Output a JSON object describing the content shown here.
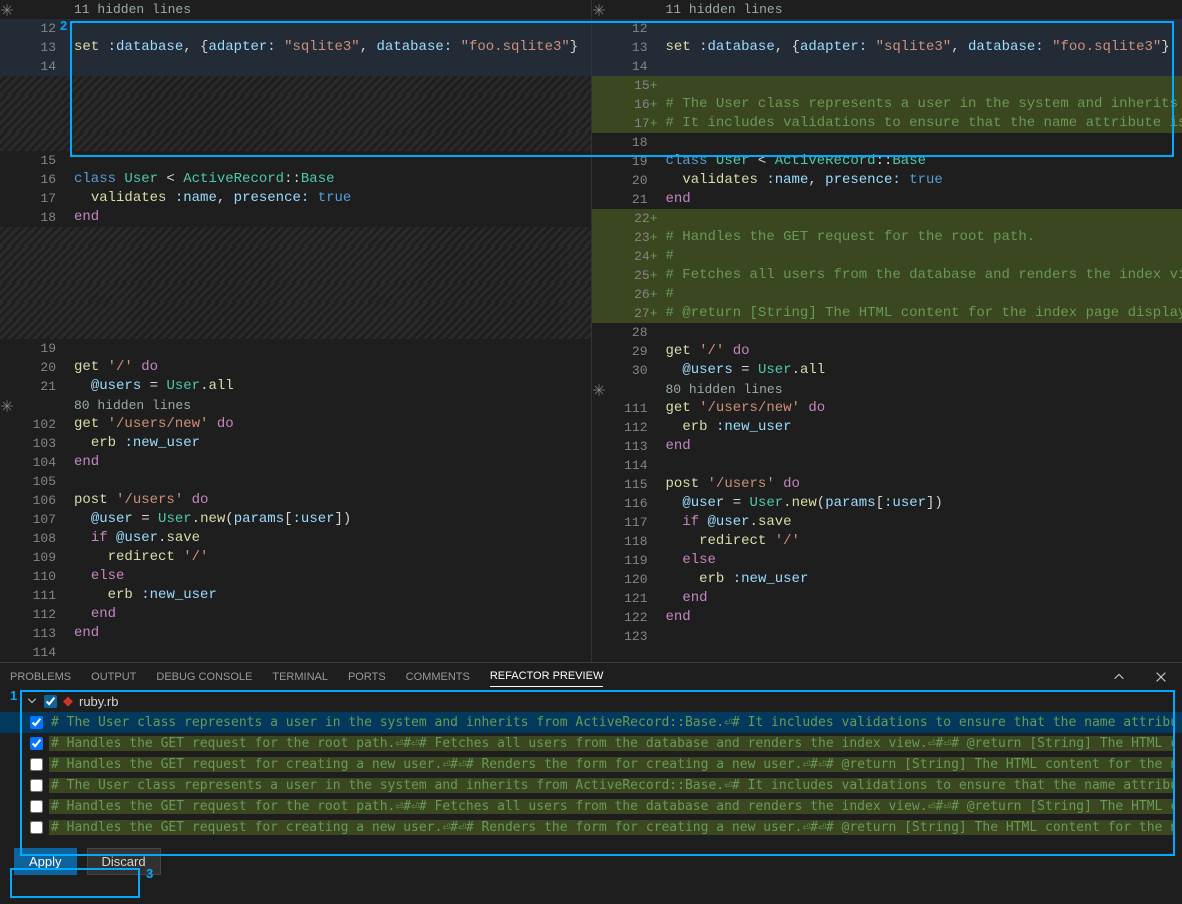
{
  "hidden_top_label": "11 hidden lines",
  "hidden_mid_label": "80 hidden lines",
  "left": {
    "lines": [
      {
        "n": "12",
        "type": "chg",
        "code": ""
      },
      {
        "n": "13",
        "type": "chg",
        "code": "<span class='tok-fn'>set</span> <span class='tok-sym'>:database</span>, {<span class='tok-sym'>adapter:</span> <span class='tok-str'>\"sqlite3\"</span>, <span class='tok-sym'>database:</span> <span class='tok-str'>\"foo.sqlite3\"</span>}"
      },
      {
        "n": "14",
        "type": "chg",
        "code": ""
      },
      {
        "n": "",
        "type": "del",
        "code": ""
      },
      {
        "n": "",
        "type": "del",
        "code": ""
      },
      {
        "n": "",
        "type": "del",
        "code": ""
      },
      {
        "n": "",
        "type": "del",
        "code": ""
      },
      {
        "n": "15",
        "type": "",
        "code": ""
      },
      {
        "n": "16",
        "type": "",
        "code": "<span class='tok-kw'>class</span> <span class='tok-cls'>User</span> &lt; <span class='tok-cls'>ActiveRecord</span>::<span class='tok-cls'>Base</span>"
      },
      {
        "n": "17",
        "type": "",
        "code": "  <span class='tok-fn'>validates</span> <span class='tok-sym'>:name</span>, <span class='tok-sym'>presence:</span> <span class='tok-bool'>true</span>"
      },
      {
        "n": "18",
        "type": "",
        "code": "<span class='tok-mod'>end</span>"
      },
      {
        "n": "",
        "type": "del",
        "code": ""
      },
      {
        "n": "",
        "type": "del",
        "code": ""
      },
      {
        "n": "",
        "type": "del",
        "code": ""
      },
      {
        "n": "",
        "type": "del",
        "code": ""
      },
      {
        "n": "",
        "type": "del",
        "code": ""
      },
      {
        "n": "",
        "type": "del",
        "code": ""
      },
      {
        "n": "19",
        "type": "",
        "code": ""
      },
      {
        "n": "20",
        "type": "",
        "code": "<span class='tok-fn'>get</span> <span class='tok-str'>'/'</span> <span class='tok-mod'>do</span>"
      },
      {
        "n": "21",
        "type": "",
        "code": "  <span class='tok-var'>@users</span> = <span class='tok-cls'>User</span>.<span class='tok-fn'>all</span>"
      }
    ],
    "lines2": [
      {
        "n": "102",
        "type": "",
        "code": "<span class='tok-fn'>get</span> <span class='tok-str'>'/users/new'</span> <span class='tok-mod'>do</span>"
      },
      {
        "n": "103",
        "type": "",
        "code": "  <span class='tok-fn'>erb</span> <span class='tok-sym'>:new_user</span>"
      },
      {
        "n": "104",
        "type": "",
        "code": "<span class='tok-mod'>end</span>"
      },
      {
        "n": "105",
        "type": "",
        "code": ""
      },
      {
        "n": "106",
        "type": "",
        "code": "<span class='tok-fn'>post</span> <span class='tok-str'>'/users'</span> <span class='tok-mod'>do</span>"
      },
      {
        "n": "107",
        "type": "",
        "code": "  <span class='tok-var'>@user</span> = <span class='tok-cls'>User</span>.<span class='tok-fn'>new</span>(<span class='tok-var'>params</span>[<span class='tok-sym'>:user</span>])"
      },
      {
        "n": "108",
        "type": "",
        "code": "  <span class='tok-mod'>if</span> <span class='tok-var'>@user</span>.<span class='tok-fn'>save</span>"
      },
      {
        "n": "109",
        "type": "",
        "code": "    <span class='tok-fn'>redirect</span> <span class='tok-str'>'/'</span>"
      },
      {
        "n": "110",
        "type": "",
        "code": "  <span class='tok-mod'>else</span>"
      },
      {
        "n": "111",
        "type": "",
        "code": "    <span class='tok-fn'>erb</span> <span class='tok-sym'>:new_user</span>"
      },
      {
        "n": "112",
        "type": "",
        "code": "  <span class='tok-mod'>end</span>"
      },
      {
        "n": "113",
        "type": "",
        "code": "<span class='tok-mod'>end</span>"
      },
      {
        "n": "114",
        "type": "",
        "code": ""
      }
    ]
  },
  "right": {
    "lines": [
      {
        "n": "12",
        "type": "chg",
        "code": ""
      },
      {
        "n": "13",
        "type": "chg",
        "code": "<span class='tok-fn'>set</span> <span class='tok-sym'>:database</span>, {<span class='tok-sym'>adapter:</span> <span class='tok-str'>\"sqlite3\"</span>, <span class='tok-sym'>database:</span> <span class='tok-str'>\"foo.sqlite3\"</span>}"
      },
      {
        "n": "14",
        "type": "chg",
        "code": ""
      },
      {
        "n": "15",
        "type": "added",
        "plus": true,
        "code": ""
      },
      {
        "n": "16",
        "type": "added",
        "plus": true,
        "code": "<span class='tok-com'># The User class represents a user in the system and inherits fro</span>"
      },
      {
        "n": "17",
        "type": "added",
        "plus": true,
        "code": "<span class='tok-com'># It includes validations to ensure that the name attribute is al</span>"
      },
      {
        "n": "18",
        "type": "",
        "code": ""
      },
      {
        "n": "19",
        "type": "",
        "code": "<span class='tok-kw'>class</span> <span class='tok-cls'>User</span> &lt; <span class='tok-cls'>ActiveRecord</span>::<span class='tok-cls'>Base</span>"
      },
      {
        "n": "20",
        "type": "",
        "code": "  <span class='tok-fn'>validates</span> <span class='tok-sym'>:name</span>, <span class='tok-sym'>presence:</span> <span class='tok-bool'>true</span>"
      },
      {
        "n": "21",
        "type": "",
        "code": "<span class='tok-mod'>end</span>"
      },
      {
        "n": "22",
        "type": "added",
        "plus": true,
        "code": ""
      },
      {
        "n": "23",
        "type": "added",
        "plus": true,
        "code": "<span class='tok-com'># Handles the GET request for the root path.</span>"
      },
      {
        "n": "24",
        "type": "added",
        "plus": true,
        "code": "<span class='tok-com'>#</span>"
      },
      {
        "n": "25",
        "type": "added",
        "plus": true,
        "code": "<span class='tok-com'># Fetches all users from the database and renders the index view.</span>"
      },
      {
        "n": "26",
        "type": "added",
        "plus": true,
        "code": "<span class='tok-com'>#</span>"
      },
      {
        "n": "27",
        "type": "added",
        "plus": true,
        "code": "<span class='tok-com'># @return [String] The HTML content for the index page displaying</span>"
      },
      {
        "n": "28",
        "type": "",
        "code": ""
      },
      {
        "n": "29",
        "type": "",
        "code": "<span class='tok-fn'>get</span> <span class='tok-str'>'/'</span> <span class='tok-mod'>do</span>"
      },
      {
        "n": "30",
        "type": "",
        "code": "  <span class='tok-var'>@users</span> = <span class='tok-cls'>User</span>.<span class='tok-fn'>all</span>"
      }
    ],
    "lines2": [
      {
        "n": "111",
        "type": "",
        "code": "<span class='tok-fn'>get</span> <span class='tok-str'>'/users/new'</span> <span class='tok-mod'>do</span>"
      },
      {
        "n": "112",
        "type": "",
        "code": "  <span class='tok-fn'>erb</span> <span class='tok-sym'>:new_user</span>"
      },
      {
        "n": "113",
        "type": "",
        "code": "<span class='tok-mod'>end</span>"
      },
      {
        "n": "114",
        "type": "",
        "code": ""
      },
      {
        "n": "115",
        "type": "",
        "code": "<span class='tok-fn'>post</span> <span class='tok-str'>'/users'</span> <span class='tok-mod'>do</span>"
      },
      {
        "n": "116",
        "type": "",
        "code": "  <span class='tok-var'>@user</span> = <span class='tok-cls'>User</span>.<span class='tok-fn'>new</span>(<span class='tok-var'>params</span>[<span class='tok-sym'>:user</span>])"
      },
      {
        "n": "117",
        "type": "",
        "code": "  <span class='tok-mod'>if</span> <span class='tok-var'>@user</span>.<span class='tok-fn'>save</span>"
      },
      {
        "n": "118",
        "type": "",
        "code": "    <span class='tok-fn'>redirect</span> <span class='tok-str'>'/'</span>"
      },
      {
        "n": "119",
        "type": "",
        "code": "  <span class='tok-mod'>else</span>"
      },
      {
        "n": "120",
        "type": "",
        "code": "    <span class='tok-fn'>erb</span> <span class='tok-sym'>:new_user</span>"
      },
      {
        "n": "121",
        "type": "",
        "code": "  <span class='tok-mod'>end</span>"
      },
      {
        "n": "122",
        "type": "",
        "code": "<span class='tok-mod'>end</span>"
      },
      {
        "n": "123",
        "type": "",
        "code": ""
      }
    ]
  },
  "panel": {
    "tabs": [
      "PROBLEMS",
      "OUTPUT",
      "DEBUG CONSOLE",
      "TERMINAL",
      "PORTS",
      "COMMENTS",
      "REFACTOR PREVIEW"
    ],
    "active": 6,
    "file": "ruby.rb",
    "items": [
      {
        "checked": true,
        "text": "# The User class represents a user in the system and inherits from ActiveRecord::Base.⏎# It includes validations to ensure that the name attribute is always present.⏎⏎class User < ActiveRecord::Base",
        "sel": true
      },
      {
        "checked": true,
        "text": "# Handles the GET request for the root path.⏎#⏎# Fetches all users from the database and renders the index view.⏎#⏎# @return [String] The HTML content for the index page displaying all users.…",
        "sel": false
      },
      {
        "checked": false,
        "text": "# Handles the GET request for creating a new user.⏎#⏎# Renders the form for creating a new user.⏎#⏎# @return [String] The HTML content for the new user form.⏎⏎get '/users/new' do",
        "sel": false
      },
      {
        "checked": false,
        "text": "# The User class represents a user in the system and inherits from ActiveRecord::Base.⏎# It includes validations to ensure that the name attribute is always present.⏎⏎class User < ActiveRecord::Base",
        "sel": false
      },
      {
        "checked": false,
        "text": "# Handles the GET request for the root path.⏎#⏎# Fetches all users from the database and renders the index view.⏎#⏎# @return [String] The HTML content for the index page displaying all users.…",
        "sel": false
      },
      {
        "checked": false,
        "text": "# Handles the GET request for creating a new user.⏎#⏎# Renders the form for creating a new user.⏎#⏎# @return [String] The HTML content for the new user form.⏎⏎get '/users/new' do",
        "sel": false
      }
    ]
  },
  "buttons": {
    "apply": "Apply",
    "discard": "Discard"
  },
  "callouts": {
    "c1": "1",
    "c2": "2",
    "c3": "3"
  }
}
